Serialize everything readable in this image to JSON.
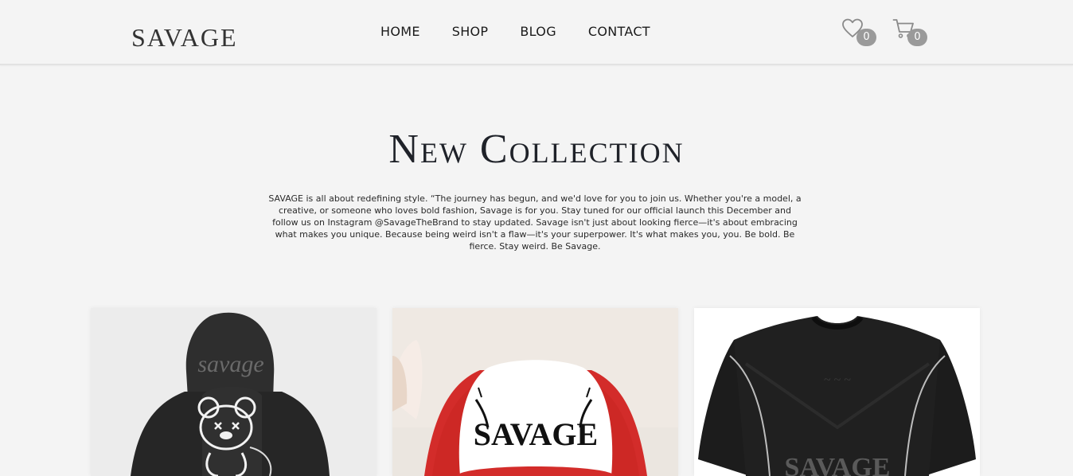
{
  "brand": {
    "logo": "SAVAGE"
  },
  "nav": {
    "items": [
      "HOME",
      "SHOP",
      "BLOG",
      "CONTACT"
    ]
  },
  "header_actions": {
    "wishlist_count": "0",
    "cart_count": "0",
    "wishlist_icon": "heart-icon",
    "cart_icon": "cart-icon"
  },
  "hero": {
    "title": "New Collection",
    "description": "SAVAGE is all about redefining style. “The journey has begun, and we'd love for you to join us. Whether you're a model, a creative, or someone who loves bold fashion, Savage is for you. Stay tuned for our official launch this December and follow us on Instagram @SavageTheBrand to stay updated. Savage isn't just about looking fierce—it's about embracing what makes you unique. Because being weird isn't a flaw—it's your superpower. It's what makes you, you. Be bold. Be fierce. Stay weird. Be Savage."
  },
  "products": [
    {
      "image": "black hoodie with savage print and teddy bear graphic"
    },
    {
      "image": "red and white trucker cap with SAVAGE logo"
    },
    {
      "image": "black t-shirt with zipper shoulders and savage print"
    }
  ],
  "image_text": {
    "hoodie_print": "savage",
    "cap_print": "SAVAGE",
    "tshirt_print": "SAVAGE"
  },
  "colors": {
    "background": "#f4f4f4",
    "badge": "#9a9a9a",
    "text": "#1f2229"
  }
}
